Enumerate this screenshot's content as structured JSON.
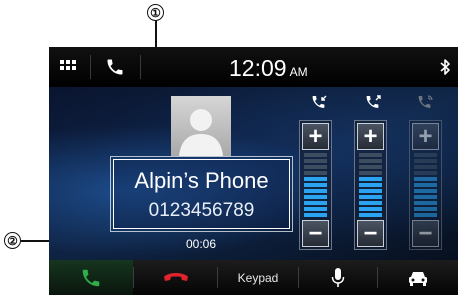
{
  "callouts": {
    "one": "①",
    "two": "②"
  },
  "status": {
    "time": "12:09",
    "ampm": "AM"
  },
  "contact": {
    "name": "Alpin’s Phone",
    "number": "0123456789"
  },
  "call": {
    "duration": "00:06"
  },
  "volumes": [
    {
      "id": "incoming",
      "level": 0.63,
      "enabled": true
    },
    {
      "id": "outgoing",
      "level": 0.63,
      "enabled": true
    },
    {
      "id": "ringtone",
      "level": 0.63,
      "enabled": false
    }
  ],
  "volume_buttons": {
    "plus": "+",
    "minus": "−"
  },
  "bottombar": {
    "keypad_label": "Keypad"
  },
  "colors": {
    "accept": "#2fae4a",
    "end": "#e0242b",
    "level_on": "#2aa3f0",
    "level_off": "#3b4d5f"
  }
}
